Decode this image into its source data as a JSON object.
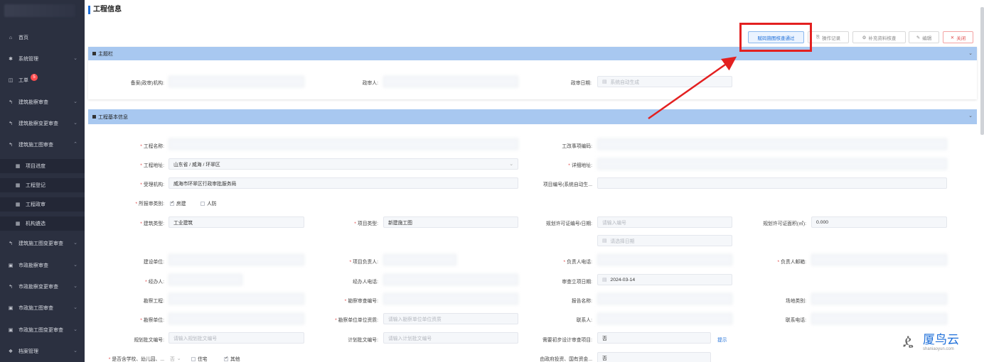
{
  "sidebar": {
    "items": [
      {
        "icon": "home-icon",
        "glyph": "⌂",
        "label": "首页",
        "chevron": ""
      },
      {
        "icon": "gear-icon",
        "glyph": "✱",
        "label": "系统管理",
        "chevron": "⌄"
      },
      {
        "icon": "form-icon",
        "glyph": "◫",
        "label": "工单",
        "badge": "5",
        "chevron": ""
      },
      {
        "icon": "survey-icon",
        "glyph": "↰",
        "label": "建筑勘察审查",
        "chevron": "⌄"
      },
      {
        "icon": "survey-change-icon",
        "glyph": "↰",
        "label": "建筑勘察变更审查",
        "chevron": "⌄"
      },
      {
        "icon": "construction-icon",
        "glyph": "↰",
        "label": "建筑施工图审查",
        "chevron": "⌃"
      },
      {
        "icon": "grid-icon",
        "glyph": "▦",
        "label": "项目进度",
        "sub": true
      },
      {
        "icon": "grid-icon",
        "glyph": "▦",
        "label": "工程登记",
        "sub": true
      },
      {
        "icon": "grid-icon",
        "glyph": "▦",
        "label": "工程政审",
        "sub": true
      },
      {
        "icon": "grid-icon",
        "glyph": "▦",
        "label": "机构遴选",
        "sub": true
      },
      {
        "icon": "construction-change-icon",
        "glyph": "↰",
        "label": "建筑施工图变更审查",
        "chevron": "⌄"
      },
      {
        "icon": "municipal-icon",
        "glyph": "▣",
        "label": "市政勘察审查",
        "chevron": "⌄"
      },
      {
        "icon": "municipal-change-icon",
        "glyph": "↰",
        "label": "市政勘察变更审查",
        "chevron": "⌄"
      },
      {
        "icon": "municipal-construction-icon",
        "glyph": "▣",
        "label": "市政施工图审查",
        "chevron": "⌄"
      },
      {
        "icon": "municipal-construction-change-icon",
        "glyph": "▣",
        "label": "市政施工图变更审查",
        "chevron": "⌄"
      },
      {
        "icon": "archive-icon",
        "glyph": "❖",
        "label": "档案管理",
        "chevron": "⌄"
      }
    ]
  },
  "page": {
    "title": "工程信息"
  },
  "toolbar": {
    "pass_label": "赋码施图核查通过",
    "log_label": "操作记录",
    "supplement_label": "补充资料核查",
    "edit_label": "编辑",
    "close_label": "关闭"
  },
  "section_main": {
    "title": "主题栏",
    "org_label": "备案(政审)机构:",
    "reviewer_label": "政审人:",
    "date_label": "政审日期:",
    "date_placeholder": "系统自动生成"
  },
  "section_basic": {
    "title": "工程基本信息",
    "name_label": "工程名称:",
    "item_code_label": "工改事项编码:",
    "address_label": "工程地址:",
    "address_value": "山东省 / 威海 / 环翠区",
    "detail_address_label": "详细地址:",
    "accept_org_label": "受理机构:",
    "accept_org_value": "威海市环翠区行政审批服务局",
    "project_no_label": "项目编号(系统自动生...",
    "report_type_label": "所报审类别:",
    "report_type_opt1": "房建",
    "report_type_opt2": "人防",
    "build_type_label": "建筑类型:",
    "build_type_value": "工业建筑",
    "project_type_label": "项目类型:",
    "project_type_value": "新建施工图",
    "permit_no_label": "规划许可证编号/日期:",
    "permit_no_placeholder": "请输入编号",
    "permit_date_placeholder": "请选择日期",
    "permit_area_label": "规划许可证面积(㎡):",
    "permit_area_value": "0.000",
    "builder_label": "建设单位:",
    "project_lead_label": "项目负责人:",
    "lead_phone_label": "负责人电话:",
    "lead_email_label": "负责人邮箱:",
    "handler_label": "经办人:",
    "handler_phone_label": "经办人电话:",
    "review_date_label": "审查立项日期:",
    "review_date_value": "2024-03-14",
    "survey_project_label": "勘察工程:",
    "survey_review_no_label": "勘察审查编号:",
    "report_name_label": "报告名称:",
    "site_type_label": "场地类别:",
    "survey_unit_label": "勘察单位:",
    "survey_qual_label": "勘察单位单位资质:",
    "survey_qual_placeholder": "请输入勘察单位单位资质",
    "contact_label": "联系人:",
    "contact_phone_label": "联系电话:",
    "plan_approval_label": "规划批文编号:",
    "plan_approval_placeholder": "请输入规划批文编号",
    "plan_doc_label": "计划批文编号:",
    "plan_doc_placeholder": "请输入计划批文编号",
    "need_review_label": "需要初步设计审查项目:",
    "need_review_value": "否",
    "hint_label": "提示",
    "school_label": "是否含学校、幼儿园、...",
    "school_value": "否",
    "school_opt1": "住宅",
    "school_opt2": "其他",
    "gov_invest_label": "由政府投资、国有资金...",
    "gov_invest_value": "否"
  },
  "watermark": {
    "name": "厦鸟云",
    "url": "shaniaoyun.com"
  },
  "colors": {
    "accent": "#1e6fd9",
    "section_bar": "#a8c8f0",
    "sidebar": "#2b3040",
    "highlight": "#e32020"
  }
}
